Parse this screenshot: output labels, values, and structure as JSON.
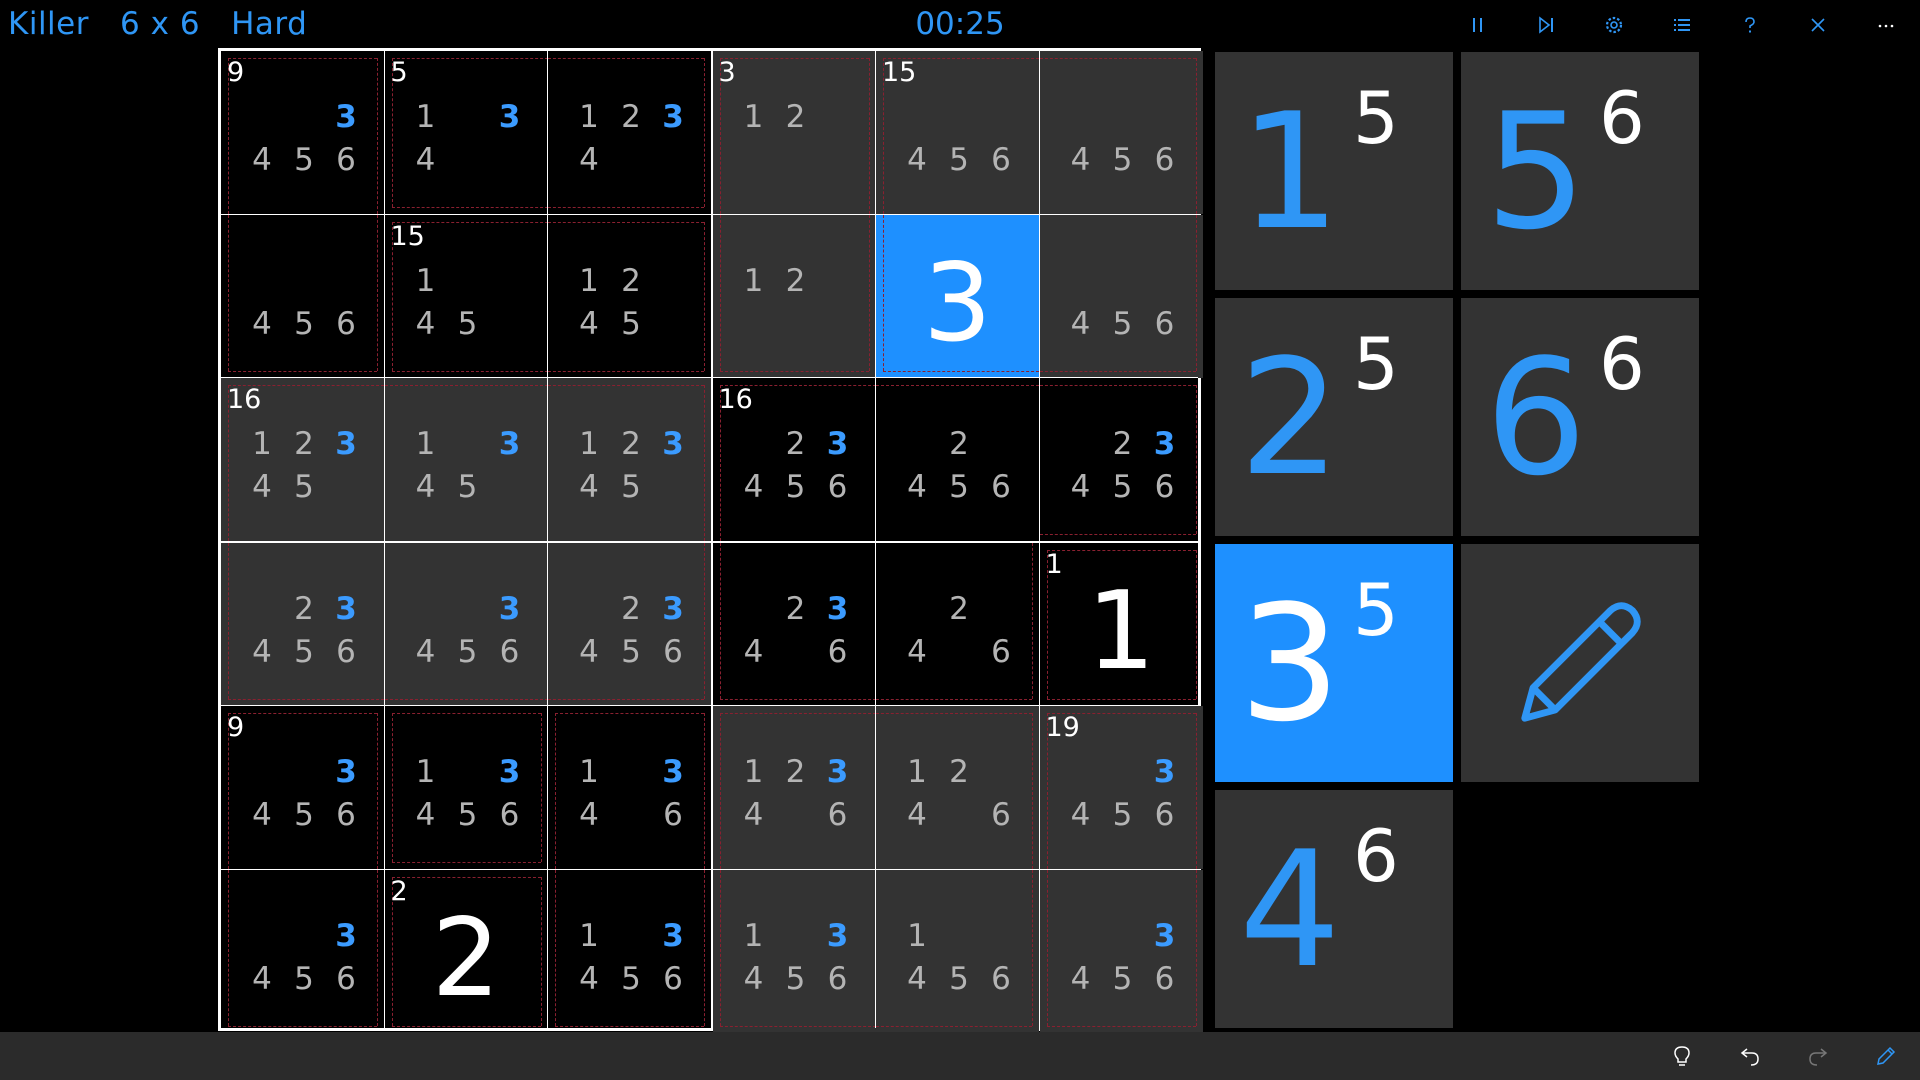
{
  "header": {
    "title": "Killer   6 x 6   Hard",
    "timer": "00:25",
    "icons": [
      "pause-icon",
      "skip-next-icon",
      "settings-icon",
      "list-icon",
      "help-icon",
      "close-icon",
      "more-icon"
    ]
  },
  "board": {
    "size": 6,
    "shaded": [
      [
        0,
        0,
        0,
        1,
        1,
        1
      ],
      [
        0,
        0,
        0,
        1,
        1,
        1
      ],
      [
        1,
        1,
        1,
        0,
        0,
        0
      ],
      [
        1,
        1,
        1,
        0,
        0,
        0
      ],
      [
        0,
        0,
        0,
        1,
        1,
        1
      ],
      [
        0,
        0,
        0,
        1,
        1,
        1
      ]
    ],
    "selected": [
      1,
      4
    ],
    "cages": [
      {
        "sum": "9",
        "cells": [
          [
            0,
            0
          ],
          [
            1,
            0
          ]
        ]
      },
      {
        "sum": "5",
        "cells": [
          [
            0,
            1
          ],
          [
            0,
            2
          ]
        ]
      },
      {
        "sum": "3",
        "cells": [
          [
            0,
            3
          ],
          [
            1,
            3
          ]
        ]
      },
      {
        "sum": "15",
        "cells": [
          [
            0,
            4
          ],
          [
            0,
            5
          ],
          [
            1,
            4
          ],
          [
            1,
            5
          ]
        ]
      },
      {
        "sum": "15",
        "cells": [
          [
            1,
            1
          ],
          [
            1,
            2
          ]
        ]
      },
      {
        "sum": "16",
        "cells": [
          [
            2,
            0
          ],
          [
            2,
            1
          ],
          [
            2,
            2
          ],
          [
            3,
            0
          ],
          [
            3,
            1
          ],
          [
            3,
            2
          ]
        ]
      },
      {
        "sum": "16",
        "cells": [
          [
            2,
            3
          ],
          [
            2,
            4
          ],
          [
            2,
            5
          ],
          [
            3,
            3
          ],
          [
            3,
            4
          ]
        ]
      },
      {
        "sum": "1",
        "cells": [
          [
            3,
            5
          ]
        ]
      },
      {
        "sum": "9",
        "cells": [
          [
            4,
            0
          ],
          [
            5,
            0
          ]
        ]
      },
      {
        "sum": "",
        "cells": [
          [
            4,
            1
          ]
        ]
      },
      {
        "sum": "",
        "cells": [
          [
            4,
            2
          ],
          [
            5,
            2
          ]
        ]
      },
      {
        "sum": "",
        "cells": [
          [
            4,
            3
          ],
          [
            4,
            4
          ],
          [
            5,
            3
          ],
          [
            5,
            4
          ]
        ]
      },
      {
        "sum": "19",
        "cells": [
          [
            4,
            5
          ],
          [
            5,
            5
          ]
        ]
      },
      {
        "sum": "2",
        "cells": [
          [
            5,
            1
          ]
        ]
      }
    ],
    "cells": [
      [
        {
          "cands": [
            3,
            4,
            5,
            6
          ]
        },
        {
          "cands": [
            1,
            3,
            4
          ]
        },
        {
          "cands": [
            1,
            2,
            3,
            4
          ]
        },
        {
          "cands": [
            1,
            2
          ]
        },
        {
          "cands": [
            4,
            5,
            6
          ]
        },
        {
          "cands": [
            4,
            5,
            6
          ]
        }
      ],
      [
        {
          "cands": [
            4,
            5,
            6
          ]
        },
        {
          "cands": [
            1,
            4,
            5
          ]
        },
        {
          "cands": [
            1,
            2,
            4,
            5
          ]
        },
        {
          "cands": [
            1,
            2
          ]
        },
        {
          "value": "3"
        },
        {
          "cands": [
            4,
            5,
            6
          ]
        }
      ],
      [
        {
          "cands": [
            1,
            2,
            3,
            4,
            5
          ]
        },
        {
          "cands": [
            1,
            3,
            4,
            5
          ]
        },
        {
          "cands": [
            1,
            2,
            3,
            4,
            5
          ]
        },
        {
          "cands": [
            2,
            3,
            4,
            5,
            6
          ]
        },
        {
          "cands": [
            2,
            4,
            5,
            6
          ]
        },
        {
          "cands": [
            2,
            3,
            4,
            5,
            6
          ]
        }
      ],
      [
        {
          "cands": [
            2,
            3,
            4,
            5,
            6
          ]
        },
        {
          "cands": [
            3,
            4,
            5,
            6
          ]
        },
        {
          "cands": [
            2,
            3,
            4,
            5,
            6
          ]
        },
        {
          "cands": [
            2,
            3,
            4,
            6
          ]
        },
        {
          "cands": [
            2,
            4,
            6
          ]
        },
        {
          "value": "1"
        }
      ],
      [
        {
          "cands": [
            3,
            4,
            5,
            6
          ]
        },
        {
          "cands": [
            1,
            3,
            4,
            5,
            6
          ]
        },
        {
          "cands": [
            1,
            3,
            4,
            6
          ]
        },
        {
          "cands": [
            1,
            2,
            3,
            4,
            6
          ]
        },
        {
          "cands": [
            1,
            2,
            4,
            6
          ]
        },
        {
          "cands": [
            3,
            4,
            5,
            6
          ]
        }
      ],
      [
        {
          "cands": [
            3,
            4,
            5,
            6
          ]
        },
        {
          "value": "2"
        },
        {
          "cands": [
            1,
            3,
            4,
            5,
            6
          ]
        },
        {
          "cands": [
            1,
            3,
            4,
            5,
            6
          ]
        },
        {
          "cands": [
            1,
            4,
            5,
            6
          ]
        },
        {
          "cands": [
            3,
            4,
            5,
            6
          ]
        }
      ]
    ],
    "highlight_digit": 3
  },
  "number_pad": [
    {
      "number": "1",
      "count": "5",
      "active": false
    },
    {
      "number": "5",
      "count": "6",
      "active": false
    },
    {
      "number": "2",
      "count": "5",
      "active": false
    },
    {
      "number": "6",
      "count": "6",
      "active": false
    },
    {
      "number": "3",
      "count": "5",
      "active": true
    },
    {
      "pencil": true,
      "icon": "pencil-icon"
    },
    {
      "number": "4",
      "count": "6",
      "active": false
    }
  ],
  "footer": {
    "icons": [
      "hint-bulb-icon",
      "undo-icon",
      "redo-icon",
      "edit-pen-icon"
    ]
  },
  "colors": {
    "accent": "#1e90ff",
    "shade": "#333333",
    "cage": "#8a2030",
    "candidate": "#b4b4b4"
  }
}
